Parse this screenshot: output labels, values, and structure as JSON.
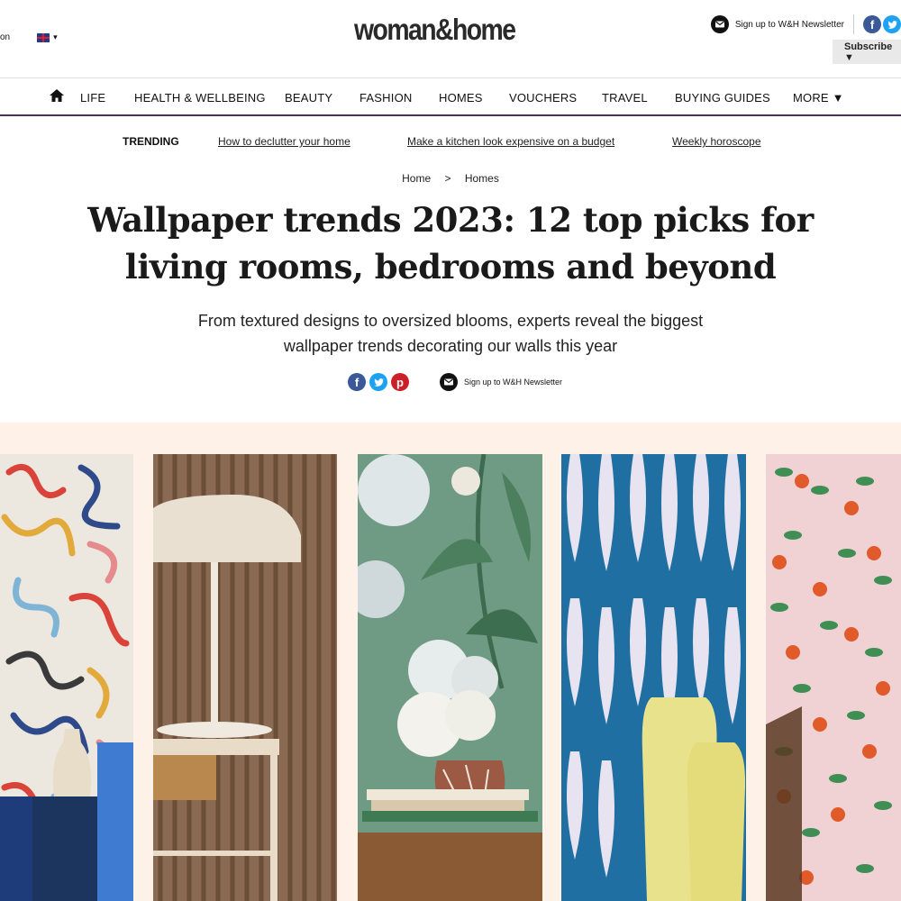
{
  "header": {
    "left_text": "on",
    "caret": "▾",
    "logo": "woman&home",
    "newsletter_label": "Sign up to W&H Newsletter",
    "social": {
      "facebook": "f",
      "twitter": "t"
    },
    "subscribe_label": "Subscribe ▼"
  },
  "nav": {
    "items": [
      "LIFE",
      "HEALTH & WELLBEING",
      "BEAUTY",
      "FASHION",
      "HOMES",
      "VOUCHERS",
      "TRAVEL",
      "BUYING GUIDES",
      "MORE ▼"
    ]
  },
  "trending": {
    "label": "TRENDING",
    "links": [
      "How to declutter your home",
      "Make a kitchen look expensive on a budget",
      "Weekly horoscope"
    ]
  },
  "breadcrumb": {
    "home": "Home",
    "separator": ">",
    "section": "Homes"
  },
  "article": {
    "headline_line1": "Wallpaper trends 2023: 12 top picks for",
    "headline_line2": "living rooms, bedrooms and beyond",
    "subhead_line1": "From textured designs to oversized blooms, experts reveal the biggest",
    "subhead_line2": "wallpaper trends decorating our walls this year"
  },
  "share": {
    "facebook": "f",
    "twitter": "t",
    "pinterest": "p",
    "newsletter_label": "Sign up to W&H Newsletter"
  },
  "hero": {
    "background": "#fdf1e8",
    "panels": [
      "abstract-squiggle-wallpaper",
      "wood-slat-wallpaper-with-lamp",
      "green-floral-wallpaper",
      "blue-geometric-wallpaper",
      "orange-tree-wallpaper"
    ]
  },
  "colors": {
    "nav_border": "#4b2f5c",
    "facebook": "#3b5998",
    "twitter": "#1da1f2",
    "pinterest": "#cb2027"
  }
}
